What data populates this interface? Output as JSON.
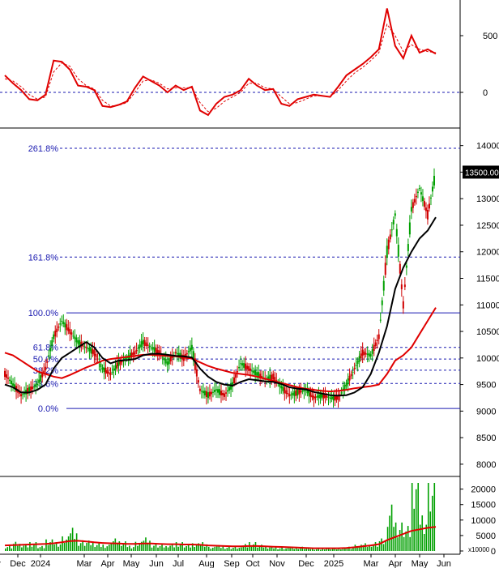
{
  "chart_data": [
    {
      "panel": "oscillator",
      "type": "line",
      "yticks": [
        500,
        0
      ],
      "ylim": [
        -300,
        800
      ],
      "zero_line": 0,
      "colors": {
        "main": "#e00000",
        "signal": "#e00000"
      },
      "x": [
        0,
        10,
        20,
        30,
        40,
        50,
        60,
        70,
        80,
        90,
        100,
        110,
        120,
        130,
        140,
        150,
        160,
        170,
        180,
        190,
        200,
        210,
        220,
        230,
        240,
        250,
        260,
        270,
        280,
        290,
        300,
        310,
        320,
        330,
        340,
        350,
        360,
        370,
        380,
        390,
        400,
        410,
        420,
        430,
        440,
        450,
        460,
        470,
        480,
        490,
        500,
        510,
        520,
        530
      ],
      "series": [
        {
          "values": [
            150,
            80,
            20,
            -60,
            -70,
            -20,
            280,
            270,
            200,
            60,
            50,
            20,
            -120,
            -130,
            -110,
            -80,
            40,
            140,
            100,
            60,
            0,
            60,
            20,
            50,
            -160,
            -200,
            -100,
            -40,
            -20,
            20,
            120,
            60,
            20,
            30,
            -100,
            -120,
            -60,
            -40,
            -20,
            -30,
            -40,
            50,
            150,
            200,
            250,
            310,
            380,
            740,
            410,
            300,
            500,
            350,
            380,
            340
          ]
        },
        {
          "values": [
            120,
            100,
            50,
            -20,
            -60,
            -40,
            180,
            260,
            230,
            120,
            60,
            30,
            -70,
            -120,
            -115,
            -90,
            0,
            100,
            110,
            80,
            30,
            40,
            40,
            40,
            -90,
            -170,
            -140,
            -80,
            -40,
            0,
            80,
            80,
            40,
            30,
            -40,
            -100,
            -90,
            -60,
            -30,
            -30,
            -40,
            20,
            100,
            170,
            220,
            280,
            350,
            600,
            500,
            360,
            420,
            380,
            360,
            350
          ]
        }
      ]
    },
    {
      "panel": "price",
      "type": "candlestick",
      "yticks": [
        14000,
        13500,
        13000,
        12500,
        12000,
        11500,
        11000,
        10500,
        10000,
        9500,
        9000,
        8500,
        8000
      ],
      "ylim": [
        7800,
        14300
      ],
      "current_price_label": "13500.00",
      "fib_levels": [
        {
          "label": "261.8%",
          "value": 13950
        },
        {
          "label": "161.8%",
          "value": 11900
        },
        {
          "label": "100.0%",
          "value": 10850
        },
        {
          "label": "61.8%",
          "value": 10200
        },
        {
          "label": "50.0%",
          "value": 9980
        },
        {
          "label": "38.2%",
          "value": 9770
        },
        {
          "label": "23.6%",
          "value": 9520
        },
        {
          "label": "0.0%",
          "value": 9050
        }
      ],
      "x": [
        0,
        10,
        20,
        30,
        40,
        50,
        60,
        70,
        80,
        90,
        100,
        110,
        120,
        130,
        140,
        150,
        160,
        170,
        180,
        190,
        200,
        210,
        220,
        230,
        240,
        250,
        260,
        270,
        280,
        290,
        300,
        310,
        320,
        330,
        340,
        350,
        360,
        370,
        380,
        390,
        400,
        410,
        420,
        430,
        440,
        450,
        460,
        470,
        480,
        490,
        500,
        510,
        520,
        530
      ],
      "close": [
        9700,
        9500,
        9300,
        9400,
        9500,
        9800,
        10400,
        10700,
        10500,
        10300,
        10200,
        10100,
        9800,
        9700,
        9900,
        10000,
        10100,
        10300,
        10200,
        10100,
        9900,
        10100,
        10000,
        10200,
        9400,
        9300,
        9400,
        9300,
        9500,
        9900,
        9800,
        9700,
        9600,
        9650,
        9450,
        9300,
        9350,
        9400,
        9250,
        9300,
        9250,
        9250,
        9500,
        9800,
        10100,
        10050,
        10400,
        12000,
        12700,
        11000,
        12800,
        13200,
        12700,
        13500
      ],
      "moving_averages": [
        {
          "color": "#e00000",
          "values": [
            10100,
            10050,
            9950,
            9850,
            9750,
            9700,
            9650,
            9620,
            9680,
            9750,
            9820,
            9880,
            9950,
            9980,
            10000,
            10020,
            10040,
            10060,
            10060,
            10050,
            10040,
            10030,
            10010,
            9990,
            9920,
            9850,
            9800,
            9760,
            9720,
            9700,
            9680,
            9650,
            9610,
            9570,
            9530,
            9490,
            9450,
            9420,
            9400,
            9380,
            9370,
            9380,
            9400,
            9430,
            9450,
            9470,
            9500,
            9700,
            9950,
            10050,
            10200,
            10450,
            10700,
            10950
          ]
        },
        {
          "color": "#000000",
          "values": [
            9500,
            9450,
            9350,
            9350,
            9400,
            9500,
            9800,
            10000,
            10100,
            10200,
            10300,
            10200,
            10000,
            9900,
            9950,
            9960,
            9980,
            10050,
            10080,
            10080,
            10060,
            10040,
            10030,
            10010,
            9800,
            9650,
            9550,
            9500,
            9480,
            9550,
            9600,
            9580,
            9560,
            9550,
            9510,
            9450,
            9420,
            9410,
            9360,
            9330,
            9300,
            9290,
            9300,
            9350,
            9450,
            9700,
            10100,
            10600,
            11300,
            11700,
            12000,
            12250,
            12400,
            12650
          ]
        }
      ]
    },
    {
      "panel": "volume",
      "type": "bar",
      "yticks": [
        20000,
        15000,
        10000,
        5000,
        0
      ],
      "ylim": [
        0,
        22000
      ],
      "multiplier_label": "x10000",
      "x": [
        0,
        10,
        20,
        30,
        40,
        50,
        60,
        70,
        80,
        90,
        100,
        110,
        120,
        130,
        140,
        150,
        160,
        170,
        180,
        190,
        200,
        210,
        220,
        230,
        240,
        250,
        260,
        270,
        280,
        290,
        300,
        310,
        320,
        330,
        340,
        350,
        360,
        370,
        380,
        390,
        400,
        410,
        420,
        430,
        440,
        450,
        460,
        470,
        480,
        490,
        500,
        510,
        520,
        530
      ],
      "values": [
        1500,
        2200,
        1800,
        2500,
        1200,
        3000,
        2500,
        3500,
        6000,
        3000,
        2500,
        2000,
        1800,
        3000,
        2500,
        1500,
        2200,
        3500,
        2000,
        1500,
        1800,
        2500,
        1500,
        2000,
        2500,
        1000,
        1500,
        1200,
        1000,
        1800,
        2500,
        1500,
        1200,
        1000,
        800,
        1000,
        1200,
        800,
        600,
        900,
        700,
        800,
        1200,
        1500,
        2000,
        2500,
        3000,
        12000,
        8000,
        6000,
        21000,
        10000,
        17000,
        7000
      ],
      "ma_color": "#e00000",
      "ma": [
        1800,
        1900,
        2000,
        2100,
        2200,
        2300,
        2500,
        2800,
        3200,
        3300,
        3100,
        2800,
        2600,
        2500,
        2400,
        2300,
        2300,
        2400,
        2400,
        2300,
        2200,
        2200,
        2100,
        2100,
        2000,
        1800,
        1700,
        1600,
        1500,
        1500,
        1600,
        1600,
        1500,
        1400,
        1300,
        1200,
        1100,
        1000,
        900,
        900,
        900,
        900,
        1000,
        1200,
        1500,
        1800,
        2200,
        3500,
        4500,
        5500,
        6500,
        7000,
        7500,
        7800
      ]
    }
  ],
  "x_axis": {
    "labels": [
      "ov",
      "Dec",
      "2024",
      "Mar",
      "Apr",
      "May",
      "Jun",
      "Jul",
      "Aug",
      "Sep",
      "Oct",
      "Nov",
      "Dec",
      "2025",
      "Mar",
      "Apr",
      "May",
      "Jun"
    ],
    "positions": [
      -5,
      22,
      50,
      104,
      133,
      162,
      193,
      220,
      255,
      286,
      312,
      342,
      378,
      412,
      458,
      488,
      518,
      548
    ]
  }
}
